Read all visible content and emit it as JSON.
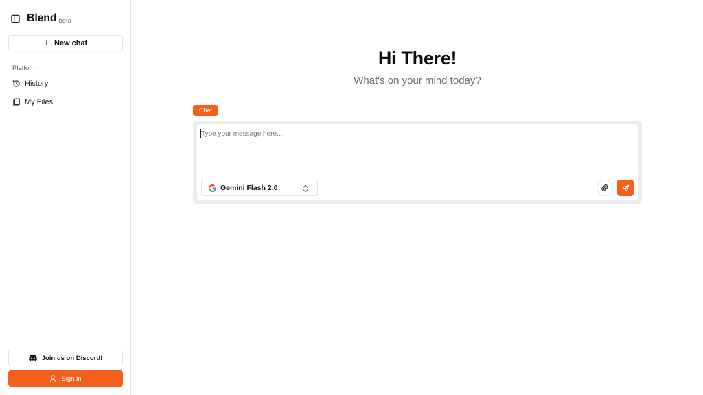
{
  "brand": {
    "name": "Blend",
    "tag": "beta"
  },
  "sidebar": {
    "new_chat_label": "New chat",
    "section_label": "Platform",
    "items": [
      {
        "label": "History",
        "icon": "history-icon"
      },
      {
        "label": "My Files",
        "icon": "files-icon"
      }
    ],
    "discord_label": "Join us on Discord!",
    "signin_label": "Sign in"
  },
  "main": {
    "title": "Hi There!",
    "subtitle": "What's on your mind today?",
    "mode_tag": "Chat",
    "input_placeholder": "Type your message here...",
    "model": {
      "label": "Gemini Flash 2.0",
      "icon": "google-icon"
    }
  },
  "colors": {
    "accent": "#f4601c",
    "border": "#e2e2e2",
    "composer_bg": "#ececec"
  }
}
